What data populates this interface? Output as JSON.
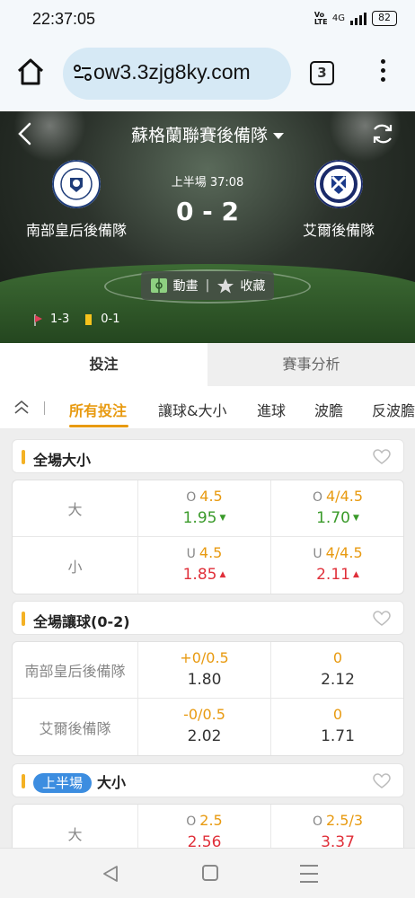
{
  "status": {
    "time": "22:37:05",
    "volte": "Vo LTE",
    "network": "4G",
    "battery": "82"
  },
  "browser": {
    "url": "ow3.3zjg8ky.com",
    "tab_count": "3"
  },
  "match": {
    "league": "蘇格蘭聯賽後備隊",
    "period": "上半場",
    "clock": "37:08",
    "score": "0 - 2",
    "home_team": "南部皇后後備隊",
    "away_team": "艾爾後備隊",
    "animation_label": "動畫",
    "favorite_label": "收藏",
    "corners": "1-3",
    "yellow_cards": "0-1"
  },
  "main_tabs": [
    {
      "label": "投注"
    },
    {
      "label": "賽事分析"
    }
  ],
  "sub_tabs": [
    {
      "label": "所有投注"
    },
    {
      "label": "讓球&大小"
    },
    {
      "label": "進球"
    },
    {
      "label": "波膽"
    },
    {
      "label": "反波膽"
    }
  ],
  "sections": [
    {
      "title": "全場大小",
      "rows": [
        {
          "label": "大",
          "cells": [
            {
              "prefix": "O",
              "line": "4.5",
              "price": "1.95",
              "trend": "down"
            },
            {
              "prefix": "O",
              "line": "4/4.5",
              "price": "1.70",
              "trend": "down"
            }
          ]
        },
        {
          "label": "小",
          "cells": [
            {
              "prefix": "U",
              "line": "4.5",
              "price": "1.85",
              "trend": "up"
            },
            {
              "prefix": "U",
              "line": "4/4.5",
              "price": "2.11",
              "trend": "up"
            }
          ]
        }
      ]
    },
    {
      "title": "全場讓球(0-2)",
      "rows": [
        {
          "label": "南部皇后後備隊",
          "cells": [
            {
              "prefix": "",
              "line": "+0/0.5",
              "price": "1.80",
              "trend": "none"
            },
            {
              "prefix": "",
              "line": "0",
              "price": "2.12",
              "trend": "none"
            }
          ]
        },
        {
          "label": "艾爾後備隊",
          "cells": [
            {
              "prefix": "",
              "line": "-0/0.5",
              "price": "2.02",
              "trend": "none"
            },
            {
              "prefix": "",
              "line": "0",
              "price": "1.71",
              "trend": "none"
            }
          ]
        }
      ]
    },
    {
      "badge": "上半場",
      "title": "大小",
      "rows": [
        {
          "label": "大",
          "cells": [
            {
              "prefix": "O",
              "line": "2.5",
              "price": "2.56",
              "trend": "up"
            },
            {
              "prefix": "O",
              "line": "2.5/3",
              "price": "3.37",
              "trend": "up"
            }
          ]
        }
      ]
    }
  ],
  "colors": {
    "accent": "#e89a10",
    "up": "#e0303a",
    "down": "#3a9a2a",
    "badge": "#3c8de0",
    "section_bar": "#f4b124"
  },
  "icons": [
    "home-icon",
    "site-settings-icon",
    "tabs-icon",
    "more-vert-icon",
    "back-icon",
    "refresh-icon",
    "animation-icon",
    "star-icon",
    "corner-flag-icon",
    "yellow-card-icon",
    "collapse-icon",
    "heart-icon"
  ]
}
